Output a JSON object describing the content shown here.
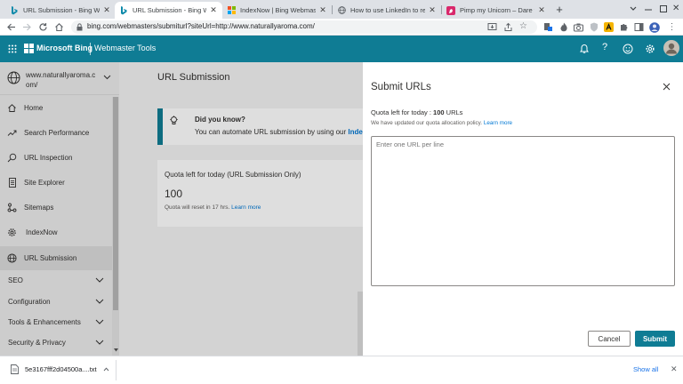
{
  "browser": {
    "tabs": [
      {
        "title": "URL Submission - Bing Webm",
        "icon": "bing-icon",
        "active": false
      },
      {
        "title": "URL Submission - Bing Webm",
        "icon": "bing-icon",
        "active": true
      },
      {
        "title": "IndexNow | Bing Webmaster",
        "icon": "microsoft-icon",
        "active": false
      },
      {
        "title": "How to use LinkedIn to reac",
        "icon": "globe-icon",
        "active": false
      },
      {
        "title": "Pimp my Unicorn – Dare to D",
        "icon": "unicorn-icon",
        "active": false
      }
    ],
    "url": "bing.com/webmasters/submiturl?siteUrl=http://www.naturallyaroma.com/"
  },
  "header": {
    "brand": "Microsoft Bing",
    "product": "Webmaster Tools"
  },
  "sidebar": {
    "site": "www.naturallyaroma.com/",
    "items": [
      {
        "label": "Home",
        "icon": "home-icon"
      },
      {
        "label": "Search Performance",
        "icon": "trend-icon"
      },
      {
        "label": "URL Inspection",
        "icon": "search-icon"
      },
      {
        "label": "Site Explorer",
        "icon": "document-icon"
      },
      {
        "label": "Sitemaps",
        "icon": "sitemap-icon"
      },
      {
        "label": "IndexNow",
        "icon": "gear-icon"
      },
      {
        "label": "URL Submission",
        "icon": "globe-icon",
        "active": true
      }
    ],
    "groups": [
      "SEO",
      "Configuration",
      "Tools & Enhancements",
      "Security & Privacy"
    ]
  },
  "main": {
    "title": "URL Submission",
    "tip": {
      "heading": "Did you know?",
      "text": "You can automate URL submission by using our",
      "link": "Index"
    },
    "quota_card": {
      "title": "Quota left for today (URL Submission Only)",
      "value": "100",
      "reset_text": "Quota will reset in 17 hrs.",
      "learn_more": "Learn more"
    }
  },
  "panel": {
    "title": "Submit URLs",
    "quota_label": "Quota left for today : ",
    "quota_value": "100",
    "quota_unit": " URLs",
    "policy_text": "We have updated our quota allocation policy.",
    "policy_link": "Learn more",
    "textarea_placeholder": "Enter one URL per line",
    "cancel_label": "Cancel",
    "submit_label": "Submit"
  },
  "download_bar": {
    "filename": "5e3167fff2d04500a....txt",
    "show_all": "Show all"
  },
  "colors": {
    "brand_teal": "#0f7c94",
    "link_blue": "#0078d4"
  }
}
